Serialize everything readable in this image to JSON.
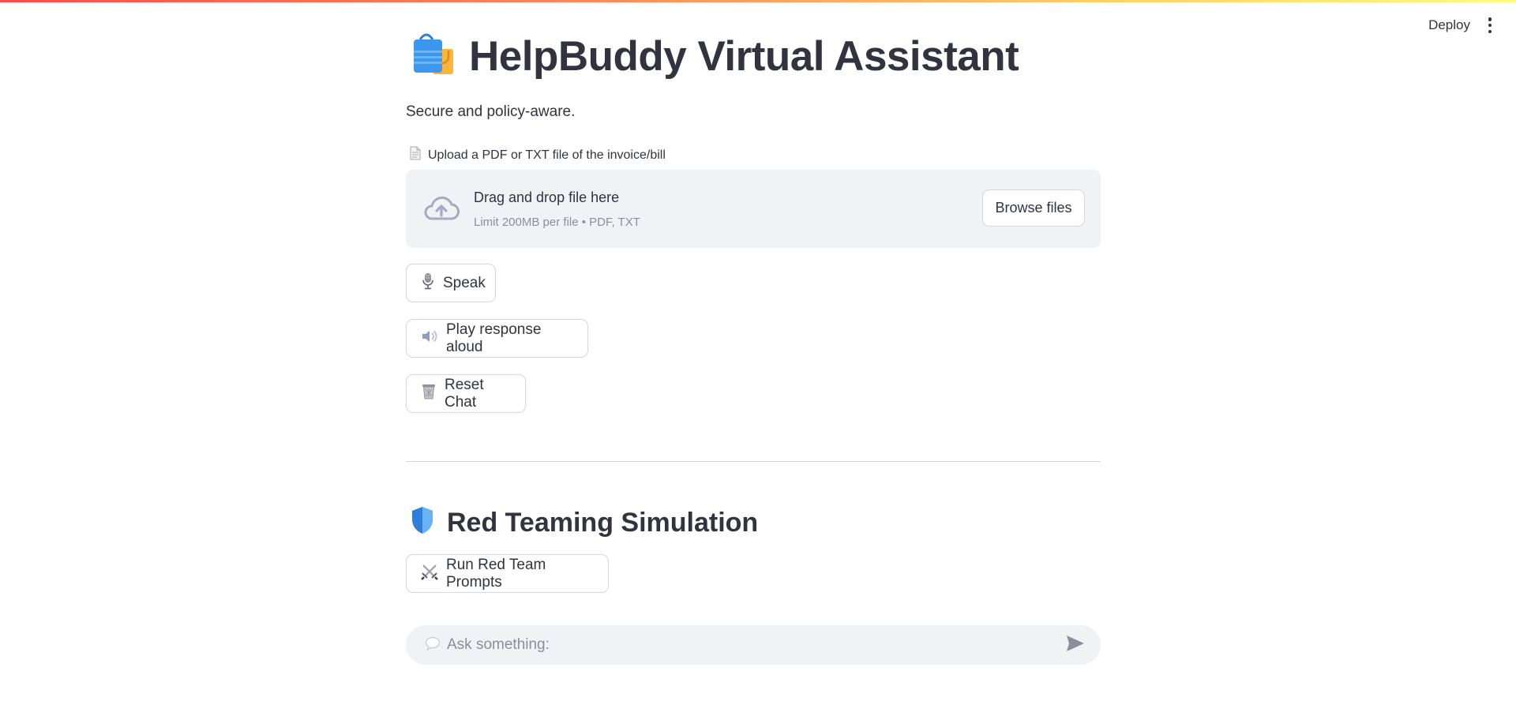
{
  "header": {
    "deploy_label": "Deploy",
    "menu_icon": "kebab-menu-icon"
  },
  "page": {
    "title_icon": "shopping-bags-emoji",
    "title": "HelpBuddy Virtual Assistant",
    "subtitle": "Secure and policy-aware."
  },
  "uploader": {
    "label_icon": "document-icon",
    "label": "Upload a PDF or TXT file of the invoice/bill",
    "dropzone_icon": "cloud-upload-icon",
    "dropzone_title": "Drag and drop file here",
    "dropzone_limit": "Limit 200MB per file • PDF, TXT",
    "browse_label": "Browse files"
  },
  "buttons": {
    "speak": {
      "icon": "microphone-icon",
      "label": "Speak"
    },
    "play": {
      "icon": "speaker-icon",
      "label": "Play response aloud"
    },
    "reset": {
      "icon": "wastebasket-icon",
      "label": "Reset Chat"
    }
  },
  "red_team": {
    "icon": "shield-icon",
    "title": "Red Teaming Simulation",
    "button_icon": "crossed-swords-icon",
    "button_label": "Run Red Team Prompts"
  },
  "chat": {
    "icon": "speech-bubble-icon",
    "placeholder": "Ask something:",
    "send_icon": "send-icon"
  },
  "colors": {
    "text": "#31333f",
    "muted": "#8b8f99",
    "surface": "#f0f2f6",
    "border": "#d5d7dc",
    "accent_red": "#ff4b4b"
  }
}
